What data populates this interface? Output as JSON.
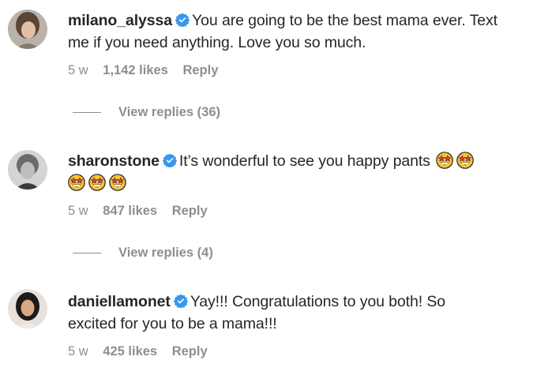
{
  "comments": [
    {
      "username": "milano_alyssa",
      "text_line1": "You are going to be the best mama ever. Text",
      "text_line2": "me if you need anything. Love you so much.",
      "age": "5 w",
      "likes": "1,142 likes",
      "reply": "Reply",
      "view_replies": "View replies (36)"
    },
    {
      "username": "sharonstone",
      "text_line1": "It’s wonderful to see you happy pants",
      "age": "5 w",
      "likes": "847 likes",
      "reply": "Reply",
      "view_replies": "View replies (4)"
    },
    {
      "username": "daniellamonet",
      "text_line1": "Yay!!! Congratulations to you both! So",
      "text_line2": "excited for you to be a mama!!!",
      "age": "5 w",
      "likes": "425 likes",
      "reply": "Reply"
    }
  ],
  "icons": {
    "verified": "verified-badge-icon",
    "emoji": "star-struck-emoji"
  },
  "colors": {
    "text": "#262626",
    "meta": "#8e8e8e",
    "verified": "#3897f0"
  }
}
